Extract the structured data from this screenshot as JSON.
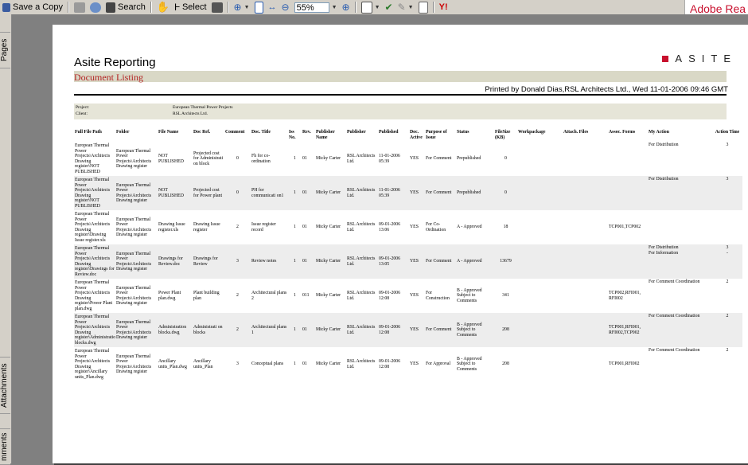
{
  "toolbar": {
    "save_copy": "Save a Copy",
    "search": "Search",
    "select": "Select",
    "zoom": "55%",
    "adobe": "Adobe Rea"
  },
  "side_tabs": {
    "pages": "Pages",
    "attachments": "Attachments",
    "comments": "mments"
  },
  "report": {
    "title": "Asite Reporting",
    "logo": "ASITE",
    "logo_suffix": "",
    "section": "Document Listing",
    "printed": "Printed by Donald Dias,RSL Architects Ltd., Wed 11-01-2006 09:46 GMT",
    "project_label": "Project:",
    "project_value": "European Thermal Power Projects",
    "client_label": "Client:",
    "client_value": "RSL Architects Ltd."
  },
  "columns": [
    "Full File Path",
    "Folder",
    "File Name",
    "Doc Ref.",
    "Comment",
    "Doc. Title",
    "Iss No.",
    "Rev.",
    "Publisher Name",
    "Publisher",
    "Published",
    "Doc. Active",
    "Purpose of Issue",
    "Status",
    "FileSize (KB)",
    "Workpackage",
    "Attach. Files",
    "Assoc. Forms",
    "My Action",
    "Action Time"
  ],
  "rows": [
    {
      "path": "European Thermal Power Projects\\Architects Drawing register\\NOT PUBLISHED",
      "folder": "European Thermal Power Projects\\Architects Drawing register",
      "file": "NOT PUBLISHED",
      "ref": "Projected cost for Administrati on block",
      "comment": "0",
      "title": "Fh for co-ordination",
      "iss": "1",
      "rev": "01",
      "pubname": "Micky Carter",
      "pub": "RSL Architects Ltd.",
      "published": "11-01-2006 05:39",
      "active": "YES",
      "purpose": "For Comment",
      "status": "Prepublished",
      "size": "0",
      "wp": "",
      "attach": "",
      "forms": "",
      "action": "For Distribution",
      "time": "3"
    },
    {
      "path": "European Thermal Power Projects\\Architects Drawing register\\NOT PUBLISHED",
      "folder": "European Thermal Power Projects\\Architects Drawing register",
      "file": "NOT PUBLISHED",
      "ref": "Projected cost for Power plant",
      "comment": "0",
      "title": "PH for communicati on1",
      "iss": "1",
      "rev": "01",
      "pubname": "Micky Carter",
      "pub": "RSL Architects Ltd.",
      "published": "11-01-2006 05:39",
      "active": "YES",
      "purpose": "For Comment",
      "status": "Prepublished",
      "size": "0",
      "wp": "",
      "attach": "",
      "forms": "",
      "action": "For Distribution",
      "time": "3"
    },
    {
      "path": "European Thermal Power Projects\\Architects Drawing register\\Drawing Issue register.xls",
      "folder": "European Thermal Power Projects\\Architects Drawing register",
      "file": "Drawing Issue register.xls",
      "ref": "Drawing Issue register",
      "comment": "2",
      "title": "Issue register record",
      "iss": "1",
      "rev": "01",
      "pubname": "Micky Carter",
      "pub": "RSL Architects Ltd.",
      "published": "09-01-2006 13:06",
      "active": "YES",
      "purpose": "For Co-Ordination",
      "status": "A - Approved",
      "size": "18",
      "wp": "",
      "attach": "",
      "forms": "TCP001,TCP002",
      "action": "",
      "time": ""
    },
    {
      "path": "European Thermal Power Projects\\Architects Drawing register\\Drawings for Review.doc",
      "folder": "European Thermal Power Projects\\Architects Drawing register",
      "file": "Drawings for Review.doc",
      "ref": "Drawings for Review",
      "comment": "3",
      "title": "Review notes",
      "iss": "1",
      "rev": "01",
      "pubname": "Micky Carter",
      "pub": "RSL Architects Ltd.",
      "published": "09-01-2006 13:05",
      "active": "YES",
      "purpose": "For Comment",
      "status": "A - Approved",
      "size": "13679",
      "wp": "",
      "attach": "",
      "forms": "",
      "action": "For Distribution\nFor Information",
      "time": "3\n-"
    },
    {
      "path": "European Thermal Power Projects\\Architects Drawing register\\Power Plant plan.dwg",
      "folder": "European Thermal Power Projects\\Architects Drawing register",
      "file": "Power Plant plan.dwg",
      "ref": "Plant building plan",
      "comment": "2",
      "title": "Architectural plans 2",
      "iss": "1",
      "rev": "011",
      "pubname": "Micky Carter",
      "pub": "RSL Architects Ltd.",
      "published": "09-01-2006 12:08",
      "active": "YES",
      "purpose": "For Construction",
      "status": "B - Approved Subject to Comments",
      "size": "341",
      "wp": "",
      "attach": "",
      "forms": "TCP002,RFI001, RFI002",
      "action": "For Comment Coordination",
      "time": "2"
    },
    {
      "path": "European Thermal Power Projects\\Architects Drawing register\\Administration blocks.dwg",
      "folder": "European Thermal Power Projects\\Architects Drawing register",
      "file": "Administration blocks.dwg",
      "ref": "Administrati on blocks",
      "comment": "2",
      "title": "Architectural plans 1",
      "iss": "1",
      "rev": "01",
      "pubname": "Micky Carter",
      "pub": "RSL Architects Ltd.",
      "published": "09-01-2006 12:08",
      "active": "YES",
      "purpose": "For Comment",
      "status": "B - Approved Subject to Comments",
      "size": "208",
      "wp": "",
      "attach": "",
      "forms": "TCP001,RFI001, RFI002,TCP002",
      "action": "For Comment Coordination",
      "time": "2"
    },
    {
      "path": "European Thermal Power Projects\\Architects Drawing register\\Ancillary units_Plan.dwg",
      "folder": "European Thermal Power Projects\\Architects Drawing register",
      "file": "Ancillary units_Plan.dwg",
      "ref": "Ancillary units_Plan",
      "comment": "3",
      "title": "Conceptual plans",
      "iss": "1",
      "rev": "01",
      "pubname": "Micky Carter",
      "pub": "RSL Architects Ltd.",
      "published": "09-01-2006 12:08",
      "active": "YES",
      "purpose": "For Approval",
      "status": "B - Approved Subject to Comments",
      "size": "208",
      "wp": "",
      "attach": "",
      "forms": "TCP001,RFI002",
      "action": "For Comment Coordination",
      "time": "2"
    }
  ]
}
